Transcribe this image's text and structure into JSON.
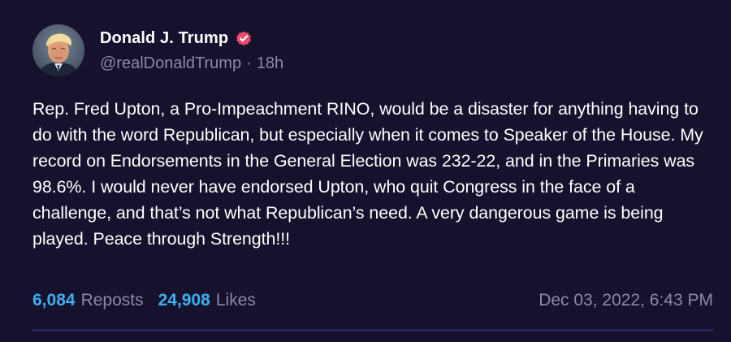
{
  "post": {
    "author": {
      "display_name": "Donald J. Trump",
      "handle": "@realDonaldTrump",
      "verified": true,
      "avatar_icon": "avatar-image"
    },
    "separator": "·",
    "relative_time": "18h",
    "text": "Rep. Fred Upton, a Pro-Impeachment RINO, would be a disaster for anything having to do with the word Republican, but especially when it comes to Speaker of the House. My record on Endorsements in the General Election was 232-22, and in the Primaries was 98.6%. I would never have endorsed Upton, who quit Congress in the face of a challenge, and that’s not what Republican’s need. A very dangerous game is being played. Peace through Strength!!!",
    "stats": {
      "reposts_count": "6,084",
      "reposts_label": "Reposts",
      "likes_count": "24,908",
      "likes_label": "Likes"
    },
    "timestamp": "Dec 03, 2022, 6:43 PM"
  },
  "colors": {
    "background": "#16122e",
    "text": "#ffffff",
    "muted": "#8b89a6",
    "accent": "#3bb0ef",
    "verified_badge": "#e94a6b",
    "divider": "#2a2660"
  }
}
